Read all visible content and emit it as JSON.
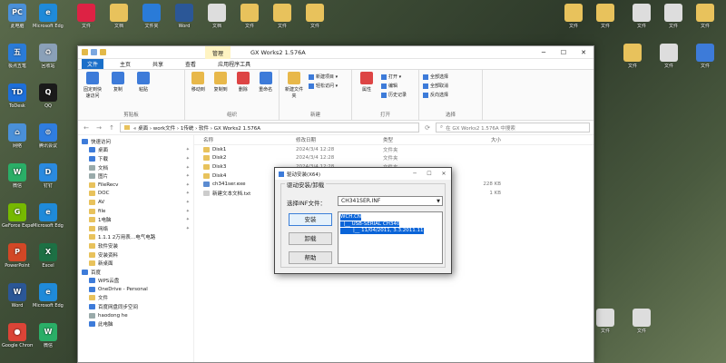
{
  "desktop": {
    "left_icons": [
      {
        "label": "此电脑",
        "color": "#4a90d9",
        "glyph": "PC"
      },
      {
        "label": "Microsoft Edge",
        "color": "#1f8ad9",
        "glyph": "e"
      },
      {
        "label": "极点五笔",
        "color": "#2a7bd8",
        "glyph": "五"
      },
      {
        "label": "回收站",
        "color": "#8aa0b8",
        "glyph": "♻"
      },
      {
        "label": "ToDesk",
        "color": "#1e6fd9",
        "glyph": "TD"
      },
      {
        "label": "QQ",
        "color": "#1a1a1a",
        "glyph": "Q"
      },
      {
        "label": "网络",
        "color": "#4a90d9",
        "glyph": "⌂"
      },
      {
        "label": "腾讯会议",
        "color": "#2f7de0",
        "glyph": "⊙"
      },
      {
        "label": "微信",
        "color": "#2aae67",
        "glyph": "W"
      },
      {
        "label": "钉钉",
        "color": "#2a8ae0",
        "glyph": "D"
      },
      {
        "label": "GeForce Experience",
        "color": "#76b900",
        "glyph": "G"
      },
      {
        "label": "Microsoft Edge",
        "color": "#1f8ad9",
        "glyph": "e"
      },
      {
        "label": "PowerPoint",
        "color": "#d24726",
        "glyph": "P"
      },
      {
        "label": "Excel",
        "color": "#1d7044",
        "glyph": "X"
      },
      {
        "label": "Word",
        "color": "#2b5797",
        "glyph": "W"
      },
      {
        "label": "Microsoft Edge",
        "color": "#1f8ad9",
        "glyph": "e"
      },
      {
        "label": "Google Chrome",
        "color": "#db4437",
        "glyph": "●"
      },
      {
        "label": "微信",
        "color": "#2aae67",
        "glyph": "W"
      }
    ],
    "top_icons": [
      {
        "label": "文件",
        "color": "#d24"
      },
      {
        "label": "文档",
        "color": "#e8c25c"
      },
      {
        "label": "文件夹",
        "color": "#2a7bd8"
      },
      {
        "label": "Word",
        "color": "#2b5797"
      },
      {
        "label": "文档",
        "color": "#ddd"
      },
      {
        "label": "文件",
        "color": "#e8c25c"
      },
      {
        "label": "文件",
        "color": "#e8c25c"
      },
      {
        "label": "文件",
        "color": "#e8c25c"
      }
    ],
    "right_icons": [
      {
        "label": "文件",
        "color": "#e8c25c"
      },
      {
        "label": "文件",
        "color": "#e8c25c"
      },
      {
        "label": "文件",
        "color": "#ddd"
      },
      {
        "label": "文件",
        "color": "#ddd"
      },
      {
        "label": "文件",
        "color": "#e8c25c"
      },
      {
        "label": "文件",
        "color": "#e8c25c"
      },
      {
        "label": "文件",
        "color": "#ddd"
      },
      {
        "label": "文件",
        "color": "#3d7bd9"
      },
      {
        "label": "文件",
        "color": "#ddd"
      },
      {
        "label": "文件",
        "color": "#ddd"
      }
    ]
  },
  "explorer": {
    "title": "GX Works2 1.576A",
    "context_tab": "管理",
    "tabs": [
      "文件",
      "主页",
      "共享",
      "查看",
      "应用程序工具"
    ],
    "ribbon": {
      "clipboard_group": "剪贴板",
      "organize_group": "组织",
      "new_group": "新建",
      "open_group": "打开",
      "select_group": "选择",
      "pin_label": "固定到快速访问",
      "copy_label": "复制",
      "paste_label": "粘贴",
      "move_label": "移动到",
      "copyto_label": "复制到",
      "delete_label": "删除",
      "rename_label": "重命名",
      "newfolder_label": "新建文件夹",
      "properties_label": "属性",
      "open_items": [
        "打开 ▾",
        "编辑",
        "历史记录"
      ],
      "select_items": [
        "全部选择",
        "全部取消",
        "反向选择"
      ],
      "new_items": [
        "新建项目 ▾",
        "轻松访问 ▾"
      ]
    },
    "address": "« 桌面 › work文件 › 1传统 › 软件 › GX Works2 1.576A",
    "search_placeholder": "在 GX Works2 1.576A 中搜索",
    "nav": [
      {
        "label": "快速访问",
        "level": 0,
        "kind": "blue"
      },
      {
        "label": "桌面",
        "level": 1,
        "kind": "blue",
        "pin": true
      },
      {
        "label": "下载",
        "level": 1,
        "kind": "blue",
        "pin": true
      },
      {
        "label": "文档",
        "level": 1,
        "kind": "gray",
        "pin": true
      },
      {
        "label": "图片",
        "level": 1,
        "kind": "gray",
        "pin": true
      },
      {
        "label": "FileRecv",
        "level": 1,
        "kind": "folder",
        "pin": true
      },
      {
        "label": "DOC",
        "level": 1,
        "kind": "folder",
        "pin": true
      },
      {
        "label": "AV",
        "level": 1,
        "kind": "folder",
        "pin": true
      },
      {
        "label": "file",
        "level": 1,
        "kind": "folder",
        "pin": true
      },
      {
        "label": "1电脑",
        "level": 1,
        "kind": "folder",
        "pin": true
      },
      {
        "label": "网络",
        "level": 1,
        "kind": "folder",
        "pin": true
      },
      {
        "label": "1.1.1 2万用表…电气电路",
        "level": 1,
        "kind": "folder",
        "pin": false
      },
      {
        "label": "软件安装",
        "level": 1,
        "kind": "folder",
        "pin": false
      },
      {
        "label": "安装资料",
        "level": 1,
        "kind": "folder",
        "pin": false
      },
      {
        "label": "新桌面",
        "level": 1,
        "kind": "folder",
        "pin": false
      },
      {
        "label": "百度",
        "level": 0,
        "kind": "blue",
        "pin": false
      },
      {
        "label": "WPS云盘",
        "level": 1,
        "kind": "blue",
        "pin": false
      },
      {
        "label": "OneDrive - Personal",
        "level": 1,
        "kind": "blue",
        "pin": false
      },
      {
        "label": "文件",
        "level": 1,
        "kind": "folder",
        "pin": false
      },
      {
        "label": "百度网盘同步空间",
        "level": 1,
        "kind": "blue",
        "pin": false
      },
      {
        "label": "haodong he",
        "level": 1,
        "kind": "gray",
        "pin": false
      },
      {
        "label": "此电脑",
        "level": 1,
        "kind": "blue",
        "pin": false
      }
    ],
    "columns": [
      "名称",
      "修改日期",
      "类型",
      "大小"
    ],
    "files": [
      {
        "name": "Disk1",
        "date": "2024/3/4 12:28",
        "type": "文件夹",
        "size": "",
        "kind": "folder"
      },
      {
        "name": "Disk2",
        "date": "2024/3/4 12:28",
        "type": "文件夹",
        "size": "",
        "kind": "folder"
      },
      {
        "name": "Disk3",
        "date": "2024/3/4 12:28",
        "type": "文件夹",
        "size": "",
        "kind": "folder"
      },
      {
        "name": "Disk4",
        "date": "2024/3/4 12:28",
        "type": "文件夹",
        "size": "",
        "kind": "folder"
      },
      {
        "name": "ch341ser.exe",
        "date": "2024/3/4 12:28",
        "type": "应用程序",
        "size": "228 KB",
        "kind": "exe"
      },
      {
        "name": "新建文本文档.txt",
        "date": "2024/3/4 12:28",
        "type": "文本文档",
        "size": "1 KB",
        "kind": "txt"
      }
    ]
  },
  "dialog": {
    "title": "驱动安装(X64)",
    "group_label": "驱动安装/卸载",
    "inf_label": "选择INF文件：",
    "inf_value": "CH341SER.INF",
    "install_label": "安装",
    "uninstall_label": "卸载",
    "help_label": "帮助",
    "info_lines": [
      "WCH.CN",
      "  |__ USB-SERIAL CH340",
      "        |__ 11/04/2011, 3.3.2011.11"
    ]
  }
}
